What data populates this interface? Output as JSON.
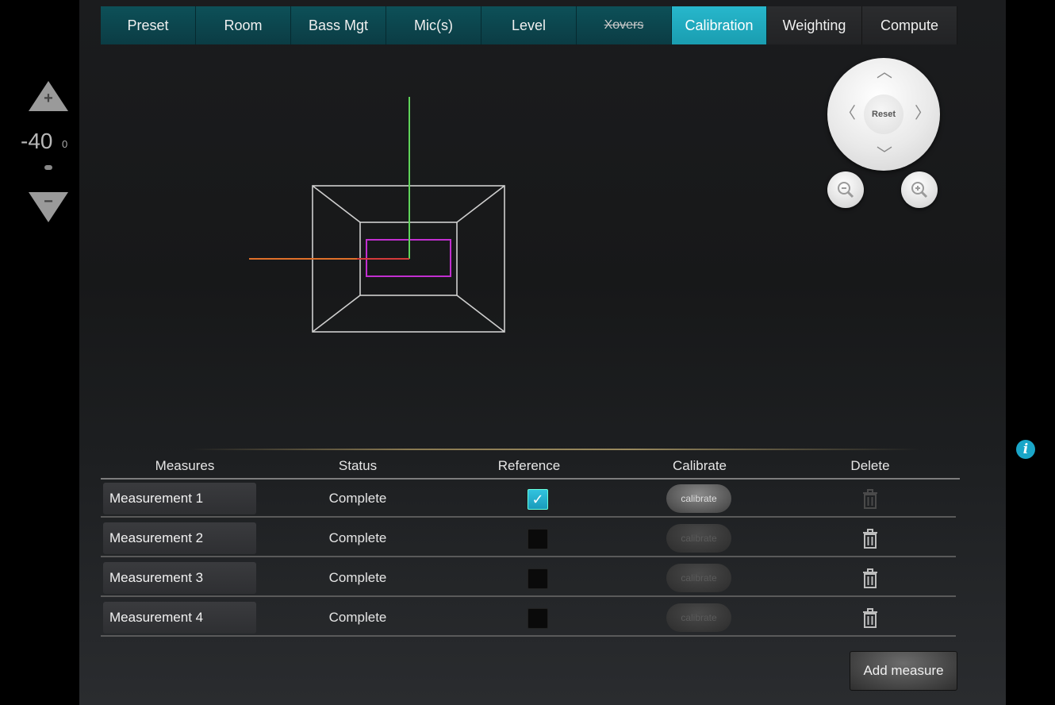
{
  "tabs": [
    {
      "label": "Preset"
    },
    {
      "label": "Room"
    },
    {
      "label": "Bass Mgt"
    },
    {
      "label": "Mic(s)"
    },
    {
      "label": "Level"
    },
    {
      "label": "Xovers"
    },
    {
      "label": "Calibration"
    },
    {
      "label": "Weighting"
    },
    {
      "label": "Compute"
    }
  ],
  "level": {
    "value": "-40",
    "unit": "0",
    "up_icon": "plus",
    "down_icon": "minus"
  },
  "nav": {
    "reset_label": "Reset"
  },
  "table": {
    "headers": {
      "measures": "Measures",
      "status": "Status",
      "reference": "Reference",
      "calibrate": "Calibrate",
      "delete": "Delete"
    },
    "rows": [
      {
        "name": "Measurement 1",
        "status": "Complete",
        "reference": true,
        "calibrate_label": "calibrate",
        "calibrate_enabled": true,
        "delete_enabled": false
      },
      {
        "name": "Measurement 2",
        "status": "Complete",
        "reference": false,
        "calibrate_label": "calibrate",
        "calibrate_enabled": false,
        "delete_enabled": true
      },
      {
        "name": "Measurement 3",
        "status": "Complete",
        "reference": false,
        "calibrate_label": "calibrate",
        "calibrate_enabled": false,
        "delete_enabled": true
      },
      {
        "name": "Measurement 4",
        "status": "Complete",
        "reference": false,
        "calibrate_label": "calibrate",
        "calibrate_enabled": false,
        "delete_enabled": true
      }
    ]
  },
  "add_measure_label": "Add measure",
  "colors": {
    "accent": "#27b7cc",
    "tab": "#0d5058",
    "axis_green": "#5fd35a",
    "axis_orange": "#e0702a",
    "seat_magenta": "#c22fd0"
  }
}
